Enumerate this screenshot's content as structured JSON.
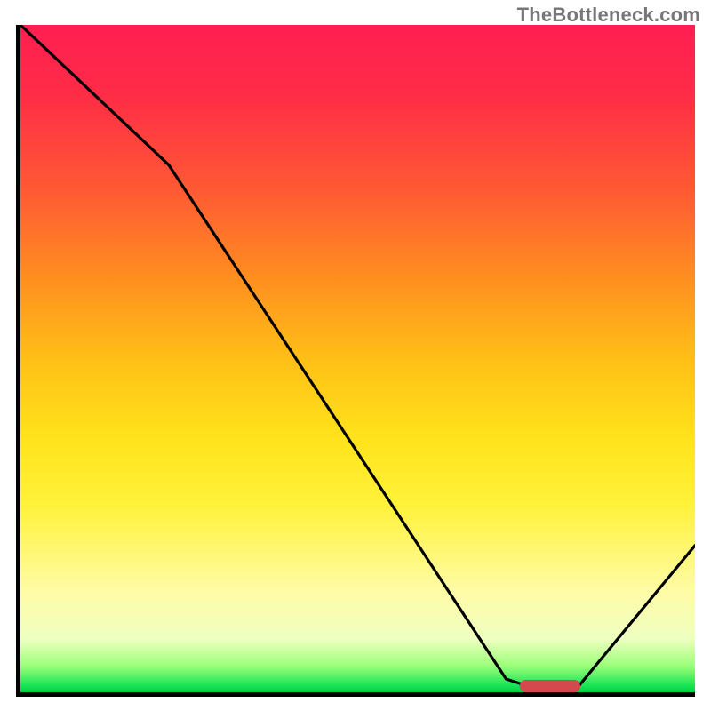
{
  "watermark": "TheBottleneck.com",
  "chart_data": {
    "type": "line",
    "title": "",
    "xlabel": "",
    "ylabel": "",
    "xlim": [
      0,
      100
    ],
    "ylim": [
      0,
      100
    ],
    "gradient_scale_note": "y=0 is green (good / no bottleneck); y=100 is red (severe bottleneck)",
    "series": [
      {
        "name": "bottleneck-curve",
        "x": [
          0,
          22,
          72,
          78,
          82,
          100
        ],
        "values": [
          100,
          79,
          2,
          0,
          0,
          22
        ]
      }
    ],
    "marker": {
      "name": "optimal-range",
      "shape": "capsule",
      "x_range": [
        74,
        83
      ],
      "y": 0,
      "color": "#d24a4d"
    }
  }
}
